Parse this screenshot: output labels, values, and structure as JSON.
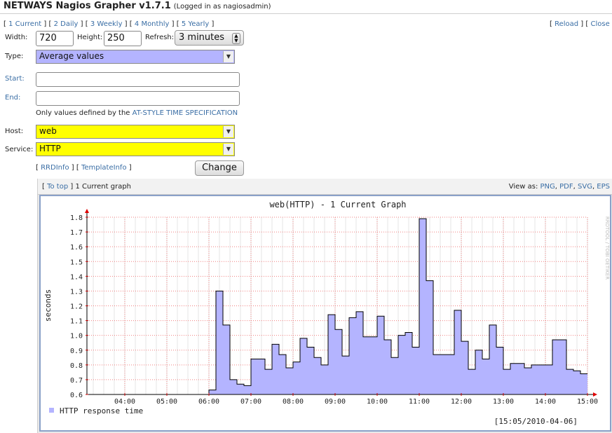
{
  "header": {
    "app_title": "NETWAYS Nagios Grapher v1.7.1",
    "login_info": "(Logged in as nagiosadmin)"
  },
  "timerange_links": [
    {
      "num": "1",
      "label": "Current"
    },
    {
      "num": "2",
      "label": "Daily"
    },
    {
      "num": "3",
      "label": "Weekly"
    },
    {
      "num": "4",
      "label": "Monthly"
    },
    {
      "num": "5",
      "label": "Yearly"
    }
  ],
  "top_actions": {
    "reload": "Reload",
    "close": "Close"
  },
  "form": {
    "width_label": "Width:",
    "width_value": "720",
    "height_label": "Height:",
    "height_value": "250",
    "refresh_label": "Refresh:",
    "refresh_value": "3 minutes",
    "type_label": "Type:",
    "type_value": "Average values",
    "start_label": "Start:",
    "end_label": "End:",
    "note_prefix": "Only values defined by the",
    "note_link": "AT-STYLE TIME SPECIFICATION",
    "host_label": "Host:",
    "host_value": "web",
    "service_label": "Service:",
    "service_value": "HTTP",
    "rrdinfo": "RRDInfo",
    "templateinfo": "TemplateInfo",
    "change_label": "Change"
  },
  "graph_section": {
    "to_top": "To top",
    "caption": "1 Current graph",
    "view_as": "View as:",
    "formats": [
      "PNG",
      "PDF",
      "SVG",
      "EPS"
    ]
  },
  "chart_data": {
    "type": "area",
    "title": "web(HTTP) - 1 Current Graph",
    "ylabel": "seconds",
    "xlabel": "",
    "ylim": [
      0.6,
      1.8
    ],
    "xlim": [
      "03:15",
      "15:00"
    ],
    "x_ticks": [
      "04:00",
      "05:00",
      "06:00",
      "07:00",
      "08:00",
      "09:00",
      "10:00",
      "11:00",
      "12:00",
      "13:00",
      "14:00",
      "15:00"
    ],
    "y_ticks": [
      "0.6",
      "0.7",
      "0.8",
      "0.9",
      "1.0",
      "1.1",
      "1.2",
      "1.3",
      "1.4",
      "1.5",
      "1.6",
      "1.7",
      "1.8"
    ],
    "grid": true,
    "series": [
      {
        "name": "HTTP response time",
        "color": "#b4b4ff",
        "points": [
          [
            "06:00",
            0.63
          ],
          [
            "06:10",
            1.3
          ],
          [
            "06:20",
            1.07
          ],
          [
            "06:30",
            0.7
          ],
          [
            "06:40",
            0.67
          ],
          [
            "06:50",
            0.66
          ],
          [
            "07:00",
            0.84
          ],
          [
            "07:10",
            0.84
          ],
          [
            "07:20",
            0.77
          ],
          [
            "07:30",
            0.94
          ],
          [
            "07:40",
            0.87
          ],
          [
            "07:50",
            0.78
          ],
          [
            "08:00",
            0.82
          ],
          [
            "08:10",
            0.98
          ],
          [
            "08:20",
            0.92
          ],
          [
            "08:30",
            0.85
          ],
          [
            "08:40",
            0.8
          ],
          [
            "08:50",
            1.14
          ],
          [
            "09:00",
            1.04
          ],
          [
            "09:10",
            0.86
          ],
          [
            "09:20",
            1.12
          ],
          [
            "09:30",
            1.16
          ],
          [
            "09:40",
            0.99
          ],
          [
            "09:50",
            0.99
          ],
          [
            "10:00",
            1.13
          ],
          [
            "10:10",
            0.97
          ],
          [
            "10:20",
            0.85
          ],
          [
            "10:30",
            1.0
          ],
          [
            "10:40",
            1.02
          ],
          [
            "10:50",
            0.92
          ],
          [
            "11:00",
            1.79
          ],
          [
            "11:10",
            1.37
          ],
          [
            "11:20",
            0.87
          ],
          [
            "11:30",
            0.87
          ],
          [
            "11:40",
            0.87
          ],
          [
            "11:50",
            1.17
          ],
          [
            "12:00",
            0.96
          ],
          [
            "12:10",
            0.77
          ],
          [
            "12:20",
            0.9
          ],
          [
            "12:30",
            0.84
          ],
          [
            "12:40",
            1.07
          ],
          [
            "12:50",
            0.92
          ],
          [
            "13:00",
            0.77
          ],
          [
            "13:10",
            0.81
          ],
          [
            "13:20",
            0.81
          ],
          [
            "13:30",
            0.78
          ],
          [
            "13:40",
            0.8
          ],
          [
            "13:50",
            0.8
          ],
          [
            "14:00",
            0.8
          ],
          [
            "14:10",
            0.97
          ],
          [
            "14:20",
            0.97
          ],
          [
            "14:30",
            0.77
          ],
          [
            "14:40",
            0.76
          ],
          [
            "14:50",
            0.74
          ]
        ]
      }
    ],
    "legend": "bottom-left",
    "timestamp": "[15:05/2010-04-06]",
    "watermark": "RRDTOOL / TOBI OETIKER"
  }
}
